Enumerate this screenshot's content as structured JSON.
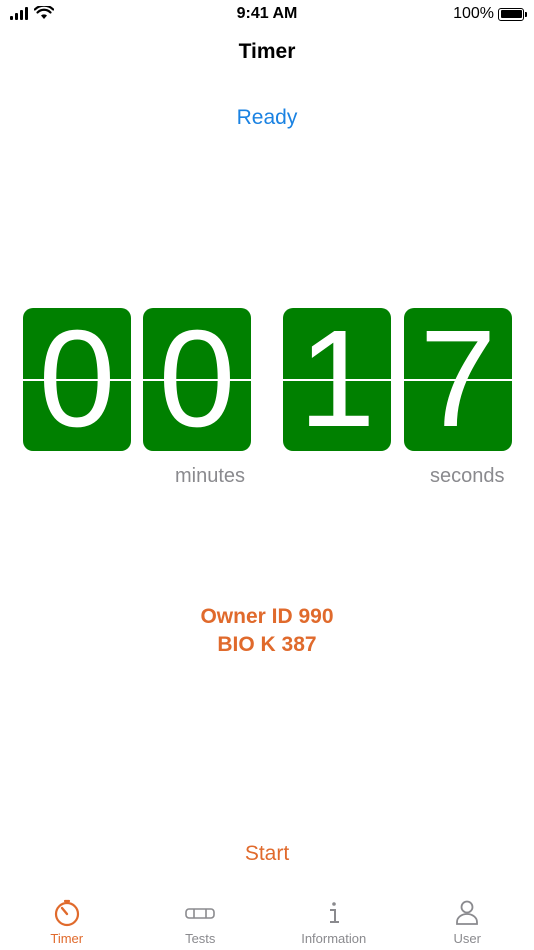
{
  "status_bar": {
    "time": "9:41 AM",
    "battery_text": "100%"
  },
  "nav": {
    "title": "Timer"
  },
  "timer": {
    "status": "Ready",
    "digits": [
      "0",
      "0",
      "1",
      "7"
    ],
    "minutes_label": "minutes",
    "seconds_label": "seconds",
    "digit_color": "#008000"
  },
  "owner": {
    "line1": "Owner ID 990",
    "line2": "BIO K 387",
    "color": "#e06a2c"
  },
  "actions": {
    "start_label": "Start"
  },
  "tab_bar": {
    "items": [
      {
        "label": "Timer",
        "icon": "stopwatch-icon",
        "active": true
      },
      {
        "label": "Tests",
        "icon": "test-strip-icon",
        "active": false
      },
      {
        "label": "Information",
        "icon": "info-icon",
        "active": false
      },
      {
        "label": "User",
        "icon": "user-icon",
        "active": false
      }
    ]
  }
}
